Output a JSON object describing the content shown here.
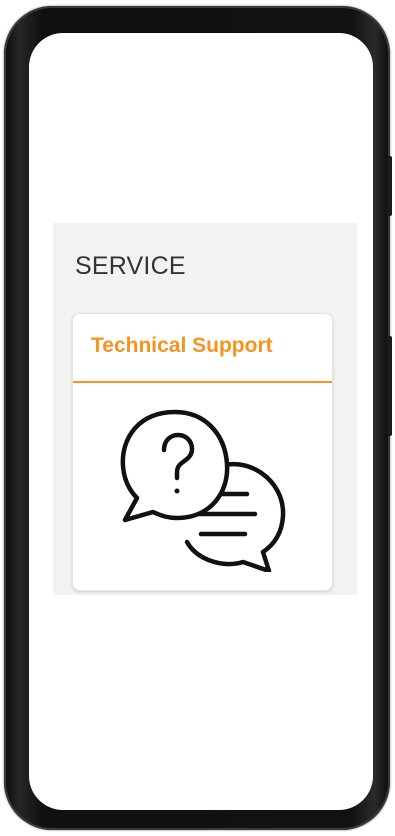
{
  "service": {
    "section_title": "SERVICE",
    "card": {
      "title": "Technical Support",
      "icon": "support-chat-bubbles-icon",
      "accent_color": "#f7931e"
    }
  }
}
